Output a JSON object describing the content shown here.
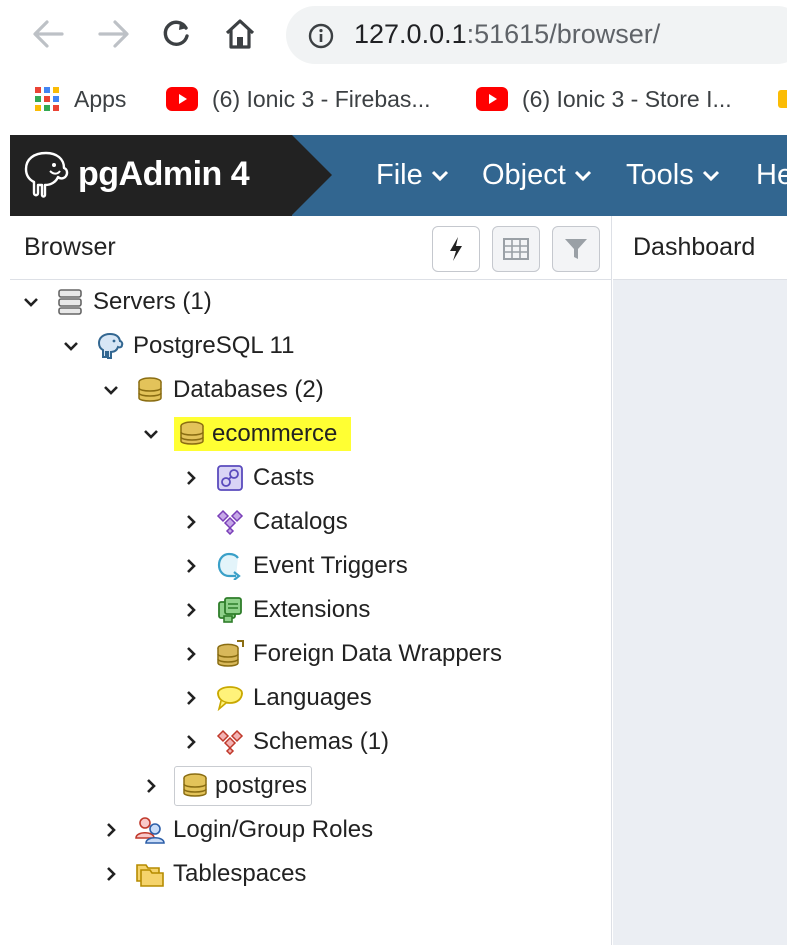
{
  "browser_chrome": {
    "nav": {
      "back_icon": "arrow-left-icon",
      "forward_icon": "arrow-right-icon",
      "reload_icon": "reload-icon",
      "home_icon": "home-icon"
    },
    "address": {
      "host": "127.0.0.1",
      "rest": ":51615/browser/"
    },
    "bookmarks": [
      {
        "label": "Apps",
        "icon": "apps-grid-icon"
      },
      {
        "label": "(6) Ionic 3 - Firebas...",
        "icon": "youtube-icon"
      },
      {
        "label": "(6) Ionic 3 - Store I...",
        "icon": "youtube-icon"
      }
    ]
  },
  "app": {
    "title": "pgAdmin 4",
    "menu": [
      "File",
      "Object",
      "Tools",
      "He"
    ]
  },
  "browser_panel": {
    "title": "Browser",
    "tools": [
      "query-tool-icon",
      "view-data-icon",
      "filter-icon"
    ]
  },
  "dashboard_panel": {
    "title": "Dashboard"
  },
  "tree": {
    "servers": "Servers (1)",
    "postgresql": "PostgreSQL 11",
    "databases": "Databases (2)",
    "ecommerce": "ecommerce",
    "casts": "Casts",
    "catalogs": "Catalogs",
    "event_triggers": "Event Triggers",
    "extensions": "Extensions",
    "fdw": "Foreign Data Wrappers",
    "languages": "Languages",
    "schemas": "Schemas (1)",
    "postgres": "postgres",
    "login_roles": "Login/Group Roles",
    "tablespaces": "Tablespaces"
  },
  "colors": {
    "pg_header": "#326690",
    "pg_brand": "#222222",
    "selection": "#ffff33",
    "youtube": "#ff0000"
  }
}
